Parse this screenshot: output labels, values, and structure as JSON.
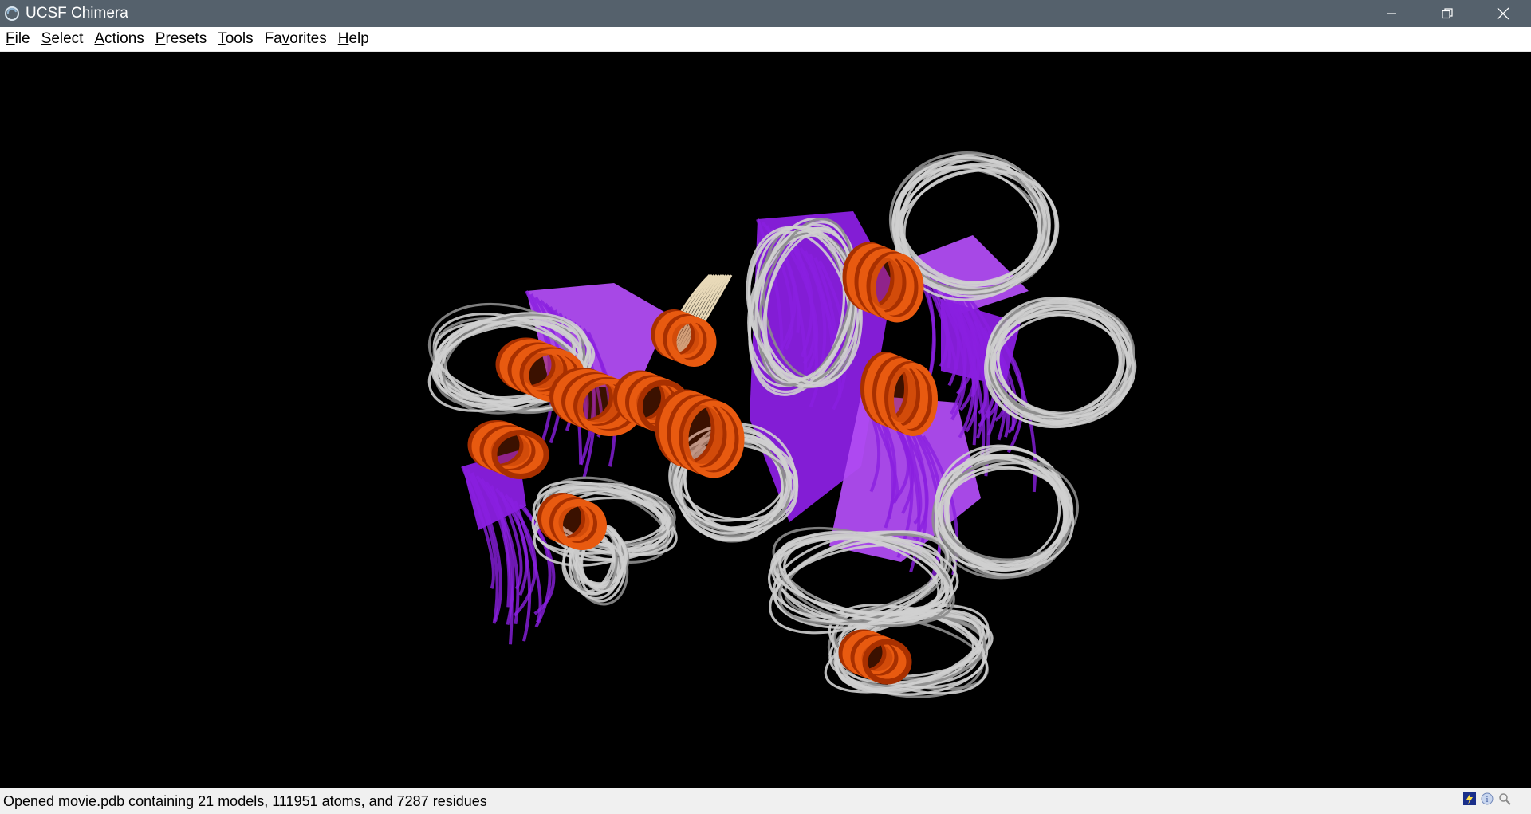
{
  "window": {
    "title": "UCSF Chimera",
    "controls": [
      "minimize-icon",
      "restore-icon",
      "close-icon"
    ]
  },
  "menubar": {
    "items": [
      {
        "pre": "",
        "mnemonic": "F",
        "post": "ile"
      },
      {
        "pre": "",
        "mnemonic": "S",
        "post": "elect"
      },
      {
        "pre": "",
        "mnemonic": "A",
        "post": "ctions"
      },
      {
        "pre": "",
        "mnemonic": "P",
        "post": "resets"
      },
      {
        "pre": "",
        "mnemonic": "T",
        "post": "ools"
      },
      {
        "pre": "Fa",
        "mnemonic": "v",
        "post": "orites"
      },
      {
        "pre": "",
        "mnemonic": "H",
        "post": "elp"
      }
    ]
  },
  "viewport": {
    "background": "#000000",
    "colors": {
      "helix": "#e85a10",
      "helix_dark": "#a83000",
      "strand": "#8a1fe0",
      "strand_light": "#b04cf2",
      "coil": "#cfcfcf",
      "coil_dark": "#8d8d8d",
      "coil_tan": "#e8d9b8"
    }
  },
  "statusbar": {
    "message": "Opened movie.pdb containing 21 models, 111951 atoms, and 7287 residues",
    "icons": [
      "lightning-icon",
      "info-icon",
      "magnifier-icon"
    ]
  }
}
